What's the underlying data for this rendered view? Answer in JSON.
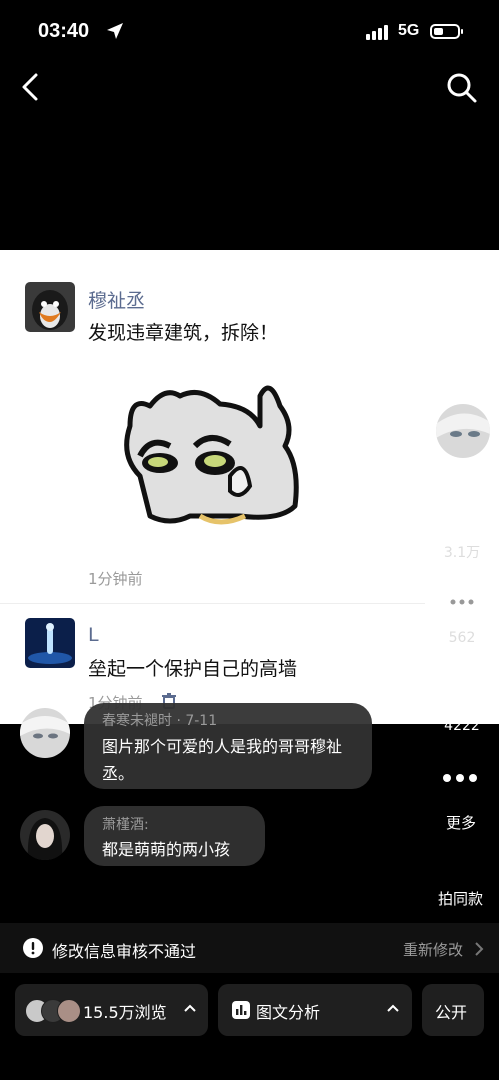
{
  "status": {
    "time": "03:40",
    "network": "5G"
  },
  "post": {
    "comments": [
      {
        "user": "穆祉丞",
        "text": "发现违章建筑，拆除！",
        "time": "1分钟前"
      },
      {
        "user": "L",
        "text": "垒起一个保护自己的高墙",
        "time": "1分钟前"
      }
    ]
  },
  "rail": {
    "like_count": "3.1万",
    "comment_count": "562",
    "fav_count": "4222",
    "more_label": "更多",
    "same_label": "拍同款"
  },
  "overlay": [
    {
      "user": "春寒未褪时 · 7-11",
      "text": "图片那个可爱的人是我的哥哥穆祉丞。"
    },
    {
      "user": "萧槿酒:",
      "text": "都是萌萌的两小孩"
    }
  ],
  "notice": {
    "text": "修改信息审核不通过",
    "action": "重新修改"
  },
  "bottom": {
    "views": "15.5万浏览",
    "analysis": "图文分析",
    "visibility": "公开"
  },
  "colors": {
    "username": "#5b6b8f",
    "background": "#000000"
  }
}
